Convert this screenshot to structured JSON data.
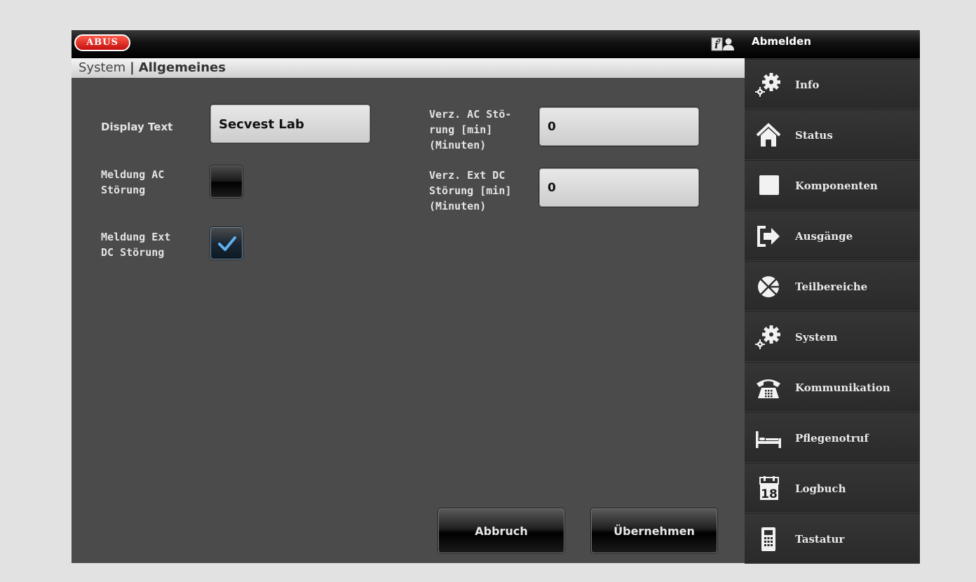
{
  "header": {
    "logo_text": "ABUS",
    "logout_label": "Abmelden"
  },
  "breadcrumb": {
    "parent": "System",
    "separator": "|",
    "current": "Allgemeines"
  },
  "form": {
    "display_text": {
      "label": "Display Text",
      "value": "Secvest Lab"
    },
    "meldung_ac": {
      "label_line1": "Meldung AC",
      "label_line2": "Störung",
      "checked": false
    },
    "meldung_ext_dc": {
      "label_line1": "Meldung Ext",
      "label_line2": "DC Störung",
      "checked": true
    },
    "verz_ac": {
      "label_line1": "Verz. AC Stö-",
      "label_line2": "rung [min]",
      "label_line3": "(Minuten)",
      "value": "0"
    },
    "verz_ext_dc": {
      "label_line1": "Verz. Ext DC",
      "label_line2": "Störung [min]",
      "label_line3": "(Minuten)",
      "value": "0"
    }
  },
  "buttons": {
    "cancel": "Abbruch",
    "apply": "Übernehmen"
  },
  "sidebar": {
    "items": [
      {
        "label": "Info",
        "icon": "gear-icon"
      },
      {
        "label": "Status",
        "icon": "home-icon"
      },
      {
        "label": "Komponenten",
        "icon": "square-icon"
      },
      {
        "label": "Ausgänge",
        "icon": "exit-icon"
      },
      {
        "label": "Teilbereiche",
        "icon": "pie-icon"
      },
      {
        "label": "System",
        "icon": "gear-icon"
      },
      {
        "label": "Kommunikation",
        "icon": "phone-icon"
      },
      {
        "label": "Pflegenotruf",
        "icon": "bed-icon"
      },
      {
        "label": "Logbuch",
        "icon": "calendar-icon",
        "icon_text": "18"
      },
      {
        "label": "Tastatur",
        "icon": "keypad-icon"
      }
    ]
  },
  "colors": {
    "logo_red": "#d41c12",
    "check_blue": "#5fb0ef"
  }
}
